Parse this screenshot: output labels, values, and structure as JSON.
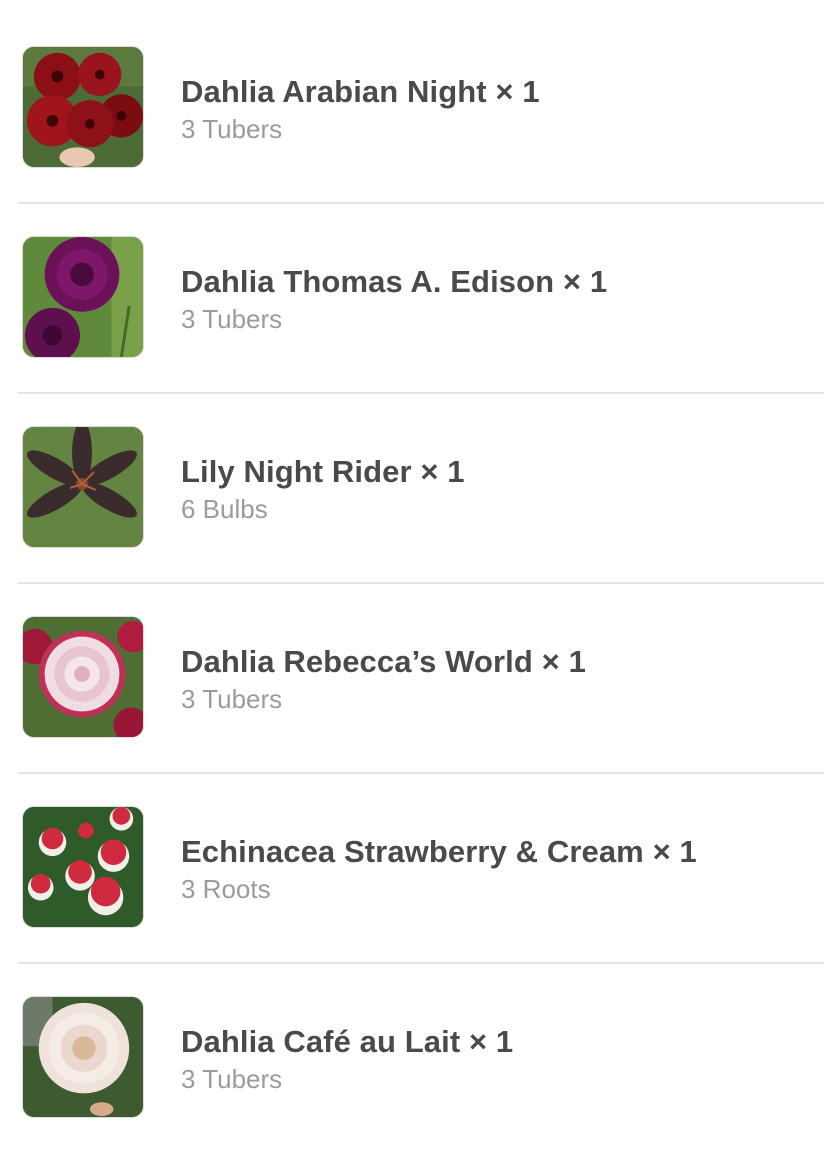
{
  "cart_items": [
    {
      "title": "Dahlia Arabian Night × 1",
      "subtitle": "3 Tubers",
      "image": "dahlia-arabian-night-photo"
    },
    {
      "title": "Dahlia Thomas A. Edison × 1",
      "subtitle": "3 Tubers",
      "image": "dahlia-thomas-edison-photo"
    },
    {
      "title": "Lily Night Rider × 1",
      "subtitle": "6 Bulbs",
      "image": "lily-night-rider-photo"
    },
    {
      "title": "Dahlia Rebecca’s World × 1",
      "subtitle": "3 Tubers",
      "image": "dahlia-rebeccas-world-photo"
    },
    {
      "title": "Echinacea Strawberry & Cream × 1",
      "subtitle": "3 Roots",
      "image": "echinacea-strawberry-cream-photo"
    },
    {
      "title": "Dahlia Café au Lait × 1",
      "subtitle": "3 Tubers",
      "image": "dahlia-cafe-au-lait-photo"
    }
  ],
  "colors": {
    "title_text": "#4a4a4a",
    "subtitle_text": "#9b9b9b",
    "divider": "#e4e4e4"
  }
}
